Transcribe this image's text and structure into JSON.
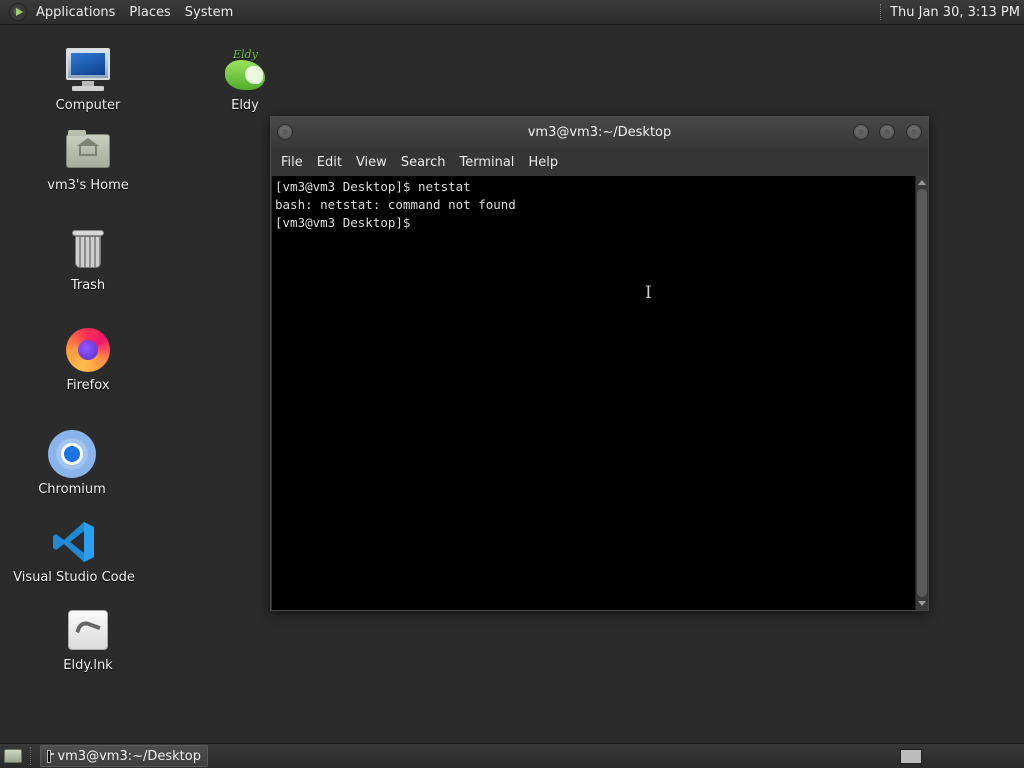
{
  "top_panel": {
    "menus": [
      "Applications",
      "Places",
      "System"
    ],
    "clock": "Thu Jan 30,  3:13 PM"
  },
  "desktop_icons": {
    "computer": "Computer",
    "eldy": "Eldy",
    "home": "vm3's Home",
    "trash": "Trash",
    "firefox": "Firefox",
    "chromium": "Chromium",
    "vscode": "Visual Studio Code",
    "eldy_lnk": "Eldy.lnk",
    "eldy_logo_text": "Eldy"
  },
  "terminal": {
    "title": "vm3@vm3:~/Desktop",
    "menu": [
      "File",
      "Edit",
      "View",
      "Search",
      "Terminal",
      "Help"
    ],
    "lines": [
      "[vm3@vm3 Desktop]$ netstat",
      "bash: netstat: command not found",
      "[vm3@vm3 Desktop]$ "
    ]
  },
  "taskbar": {
    "task_label": "vm3@vm3:~/Desktop"
  },
  "icons": {
    "distro": "distro-logo-icon",
    "show_desktop": "show-desktop-icon",
    "terminal_task": "terminal-icon"
  }
}
